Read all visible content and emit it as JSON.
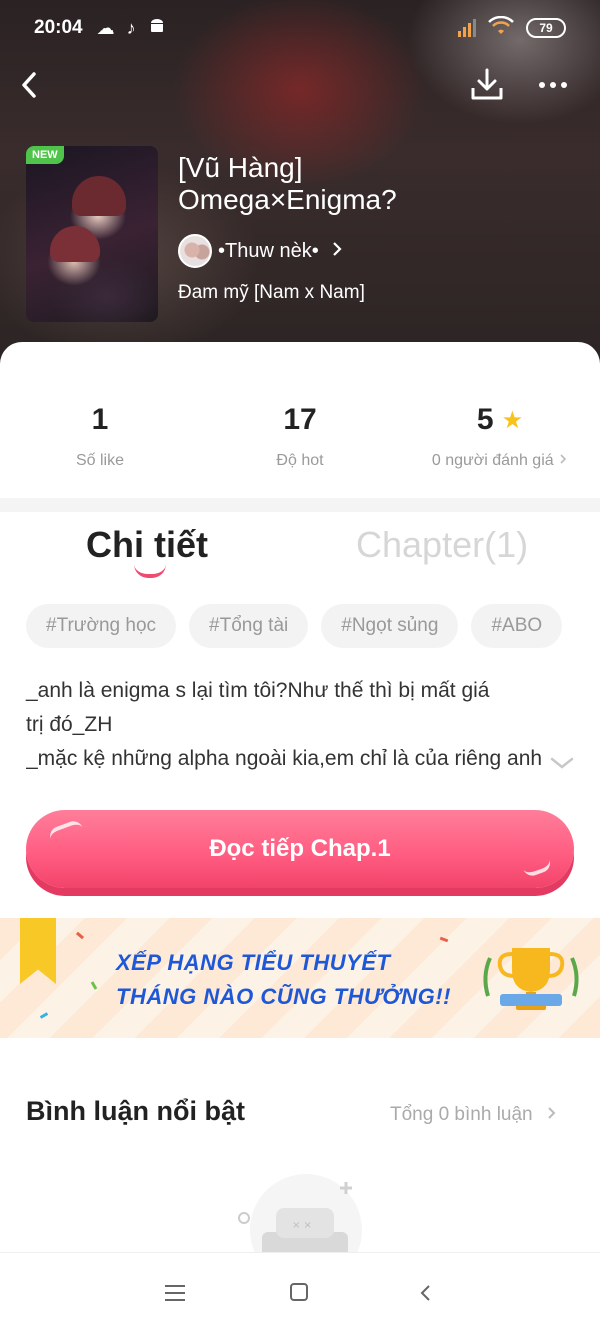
{
  "status_bar": {
    "time": "20:04",
    "battery": "79",
    "icons": [
      "weather-icon",
      "tiktok-icon",
      "android-icon",
      "signal-icon",
      "wifi-icon",
      "battery-icon"
    ]
  },
  "book": {
    "badge": "NEW",
    "title": "[Vũ Hàng] Omega×Enigma?",
    "author": "•Thuw nèk•",
    "genre": "Đam mỹ [Nam x Nam]"
  },
  "stats": [
    {
      "value": "1",
      "label": "Số like"
    },
    {
      "value": "17",
      "label": "Độ hot"
    },
    {
      "value": "5",
      "label": "0 người đánh giá"
    }
  ],
  "tabs": {
    "detail": "Chi tiết",
    "chapter": "Chapter(1)"
  },
  "tags": [
    "#Trường học",
    "#Tổng tài",
    "#Ngọt sủng",
    "#ABO"
  ],
  "description": {
    "line1": "_anh là enigma s lại tìm tôi?Như thế thì bị mất giá",
    "line2": "trị đó_ZH",
    "line3": "_mặc kệ những alpha ngoài kia,em chỉ là của riêng anh"
  },
  "read_button": "Đọc tiếp Chap.1",
  "banner": {
    "line1": "XẾP HẠNG TIỂU THUYẾT",
    "line2": "THÁNG NÀO CŨNG THƯỞNG!!"
  },
  "comments": {
    "title": "Bình luận nổi bật",
    "total": "Tổng 0 bình luận"
  },
  "colors": {
    "accent": "#ef4a71",
    "button": "#ff5b80",
    "banner_text": "#1f58d6",
    "new_badge": "#4fc34a",
    "star": "#f8c21a"
  }
}
